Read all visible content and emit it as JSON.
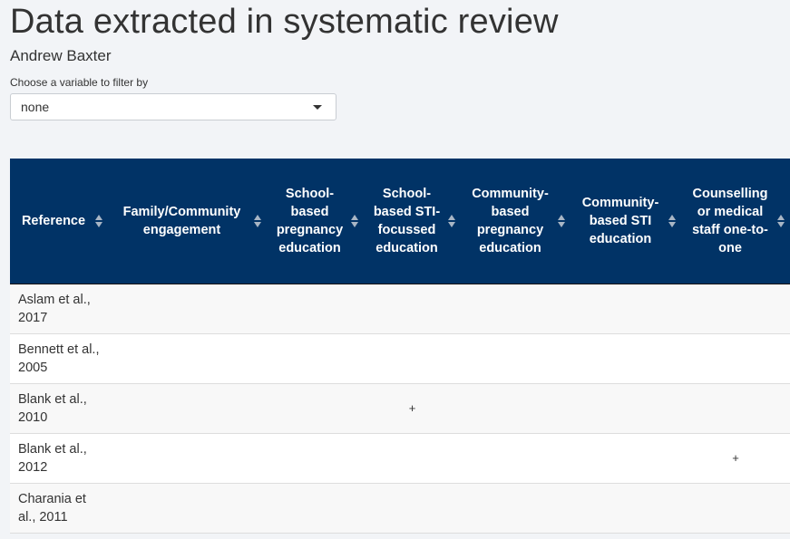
{
  "header": {
    "title": "Data extracted in systematic review",
    "author": "Andrew Baxter"
  },
  "filter": {
    "label": "Choose a variable to filter by",
    "selected": "none"
  },
  "table": {
    "columns": [
      "Reference",
      "Family/Community engagement",
      "School-based pregnancy education",
      "School-based STI-focussed education",
      "Community-based pregnancy education",
      "Community-based STI education",
      "Counselling or medical staff one-to-one"
    ],
    "rows": [
      {
        "reference": "Aslam et al., 2017",
        "cells": [
          "",
          "",
          "",
          "",
          "",
          ""
        ]
      },
      {
        "reference": "Bennett et al., 2005",
        "cells": [
          "",
          "",
          "",
          "",
          "",
          ""
        ]
      },
      {
        "reference": "Blank et al., 2010",
        "cells": [
          "",
          "",
          "+",
          "",
          "",
          ""
        ]
      },
      {
        "reference": "Blank et al., 2012",
        "cells": [
          "",
          "",
          "",
          "",
          "",
          "+"
        ]
      },
      {
        "reference": "Charania et al., 2011",
        "cells": [
          "",
          "",
          "",
          "",
          "",
          ""
        ]
      }
    ]
  }
}
